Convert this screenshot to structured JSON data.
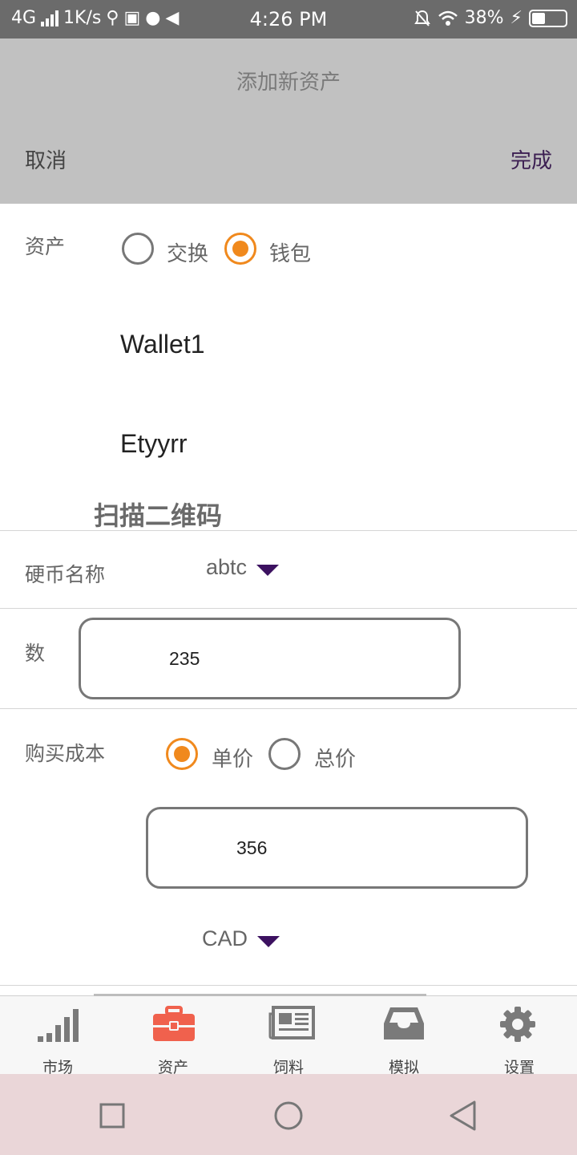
{
  "status_bar": {
    "network": "4G",
    "speed": "1K/s",
    "time": "4:26 PM",
    "battery": "38%"
  },
  "header": {
    "title": "添加新资产",
    "cancel": "取消",
    "done": "完成"
  },
  "asset": {
    "label": "资产",
    "options": [
      "交换",
      "钱包"
    ],
    "selected": "钱包",
    "wallets": [
      "Wallet1",
      "Etyyrr"
    ],
    "scan_qr": "扫描二维码"
  },
  "coin": {
    "label": "硬币名称",
    "value": "abtc"
  },
  "quantity": {
    "label": "数",
    "value": "235"
  },
  "purchase_cost": {
    "label": "购买成本",
    "options": [
      "单价",
      "总价"
    ],
    "selected": "单价",
    "value": "356",
    "currency": "CAD"
  },
  "tabs": [
    {
      "label": "市场",
      "icon": "signal-bars-icon",
      "active": false
    },
    {
      "label": "资产",
      "icon": "briefcase-icon",
      "active": true
    },
    {
      "label": "饲料",
      "icon": "newspaper-icon",
      "active": false
    },
    {
      "label": "模拟",
      "icon": "inbox-icon",
      "active": false
    },
    {
      "label": "设置",
      "icon": "gear-icon",
      "active": false
    }
  ],
  "colors": {
    "accent_orange": "#f0891d",
    "active_tab": "#f0614d",
    "done_text": "#3c1f52",
    "caret": "#3c1160",
    "header_bg": "#c1c1c1"
  }
}
